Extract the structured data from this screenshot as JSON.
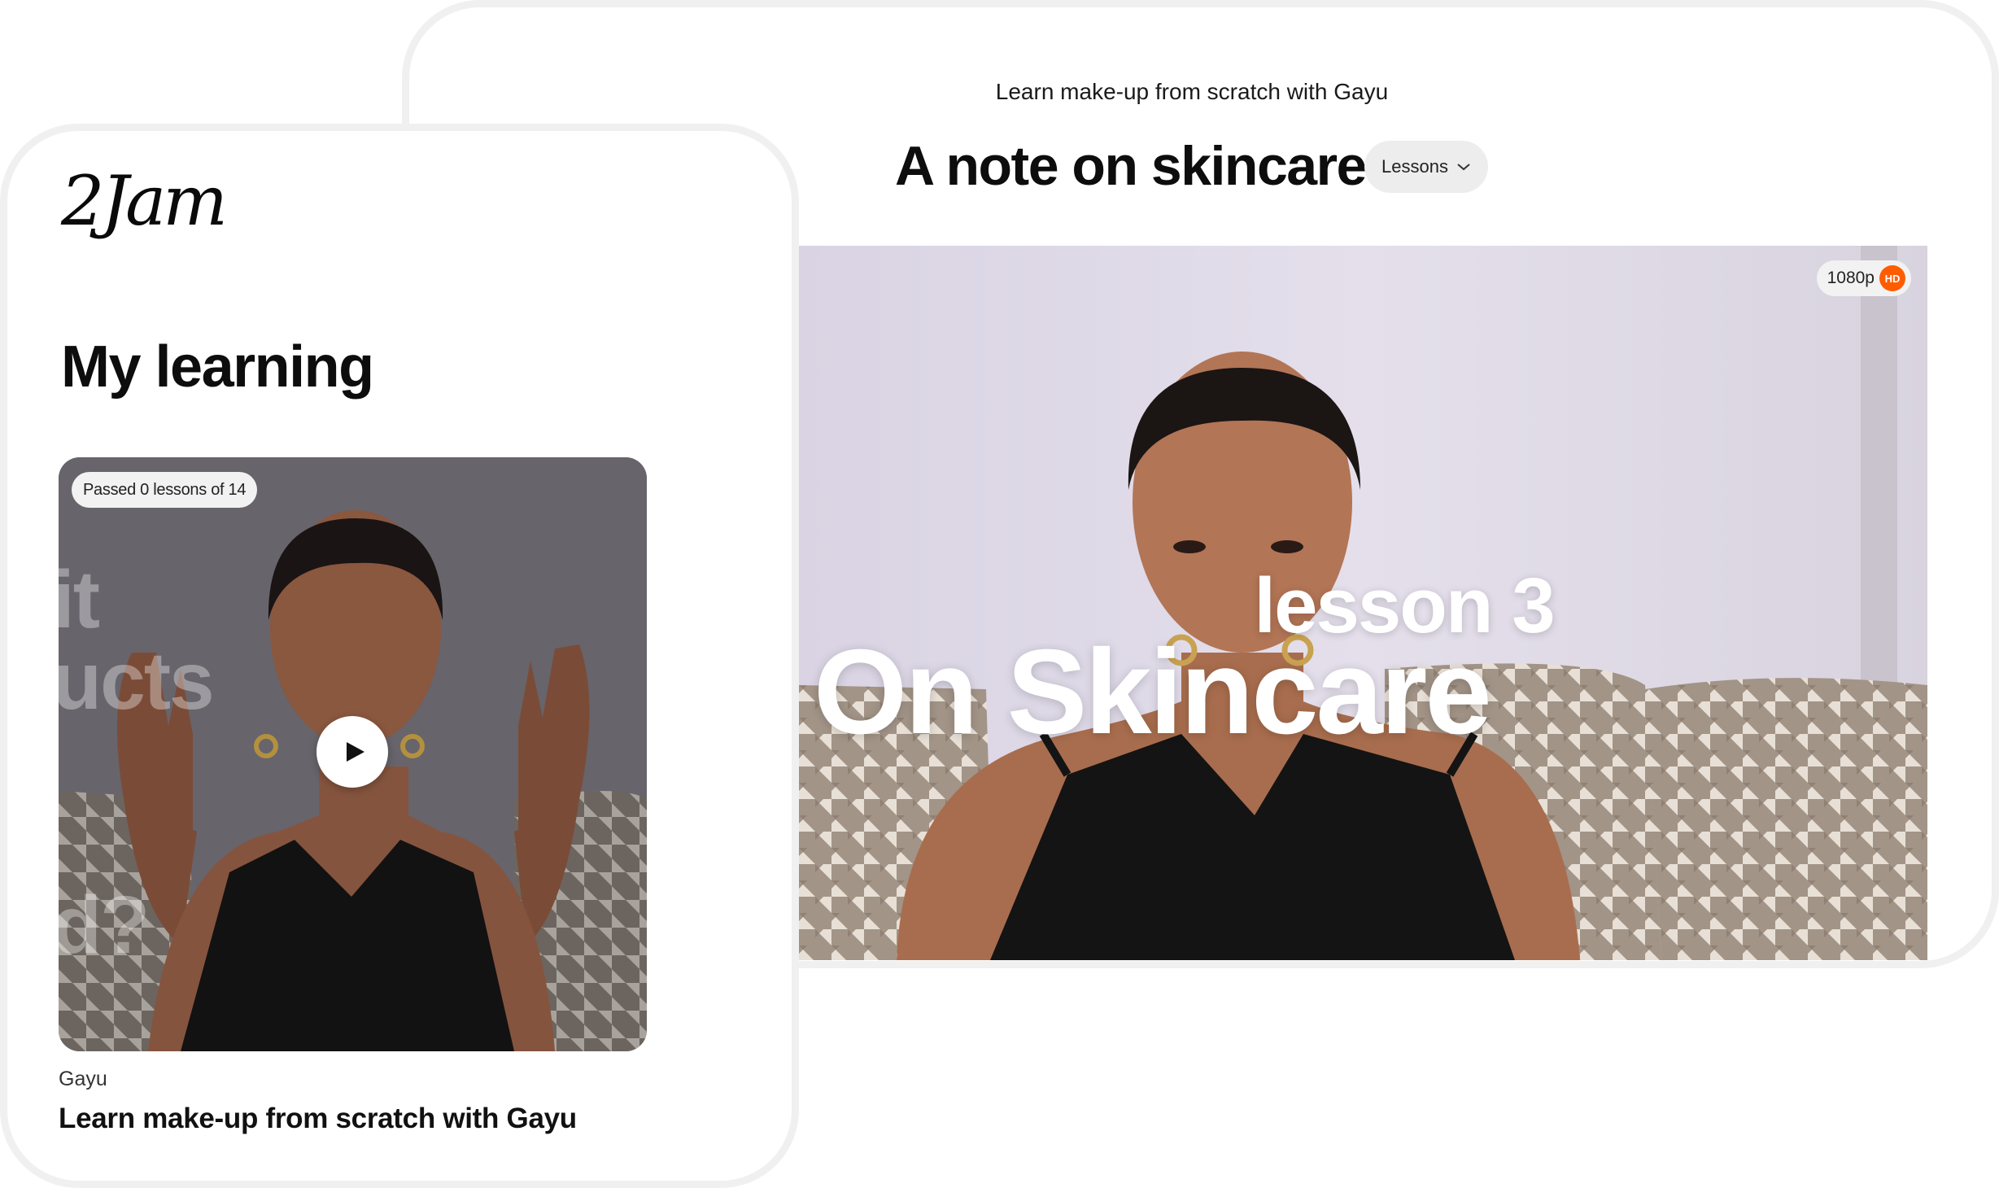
{
  "player": {
    "course_title": "Learn make-up from scratch with Gayu",
    "lesson_title": "A note on skincare",
    "lessons_dropdown": "Lessons",
    "resolution": "1080p",
    "hd_badge": "HD",
    "overlay_line1": "lesson 3",
    "overlay_line2": "On Skincare"
  },
  "learning": {
    "logo": "2Jam",
    "page_title": "My learning",
    "card": {
      "progress": "Passed 0 lessons of 14",
      "ghost_top": "it",
      "ghost_mid": "ucts",
      "ghost_bottom": "d?",
      "author": "Gayu",
      "title": "Learn make-up from scratch with Gayu"
    }
  },
  "colors": {
    "accent_hd": "#ff5c00",
    "card_border": "#f0f0f0",
    "pill_bg": "#ededed"
  },
  "icons": {
    "dropdown": "chevron-down-icon",
    "play": "play-icon"
  }
}
